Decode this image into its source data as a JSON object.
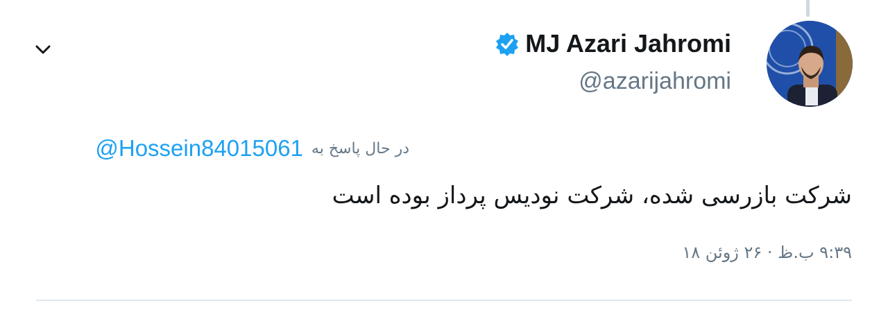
{
  "tweet": {
    "author": {
      "display_name": "MJ Azari Jahromi",
      "handle": "@azarijahromi",
      "verified_icon": "verified-badge-icon",
      "avatar_icon": "profile-avatar"
    },
    "reply_context": {
      "prefix": "در حال پاسخ به",
      "handle": "@Hossein84015061"
    },
    "text": "شرکت بازرسی شده، شرکت نودیس پرداز بوده است",
    "timestamp": "۹:۳۹ ب.ظ · ۲۶ ژوئن ۱۸",
    "menu_icon": "chevron-down-icon"
  },
  "colors": {
    "link": "#1da1f2",
    "text_primary": "#14171a",
    "text_secondary": "#657786",
    "divider": "#e1e8ed"
  }
}
